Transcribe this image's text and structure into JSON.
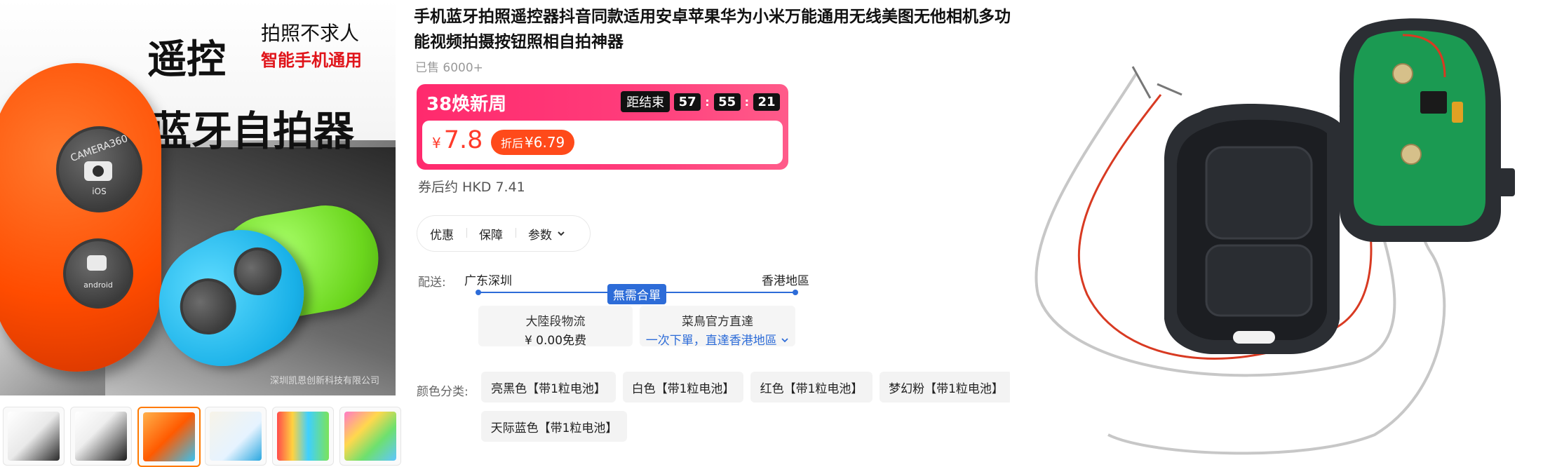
{
  "main_image": {
    "headline_1": "遥控",
    "headline_2": "拍照不求人",
    "headline_3": "智能手机通用",
    "headline_4": "蓝牙自拍器",
    "label_1": "CAMERA360",
    "label_2": "iOS",
    "label_3": "android",
    "watermark": "深圳凯恩创新科技有限公司"
  },
  "thumbnails": [
    {
      "active": false
    },
    {
      "active": false
    },
    {
      "active": true
    },
    {
      "active": false
    },
    {
      "active": false
    },
    {
      "active": false
    }
  ],
  "product": {
    "title": "手机蓝牙拍照遥控器抖音同款适用安卓苹果华为小米万能通用无线美图无他相机多功能视频拍摄按钮照相自拍神器",
    "sold": "已售 6000+"
  },
  "promo": {
    "title": "38焕新周",
    "countdown_label": "距结束",
    "hours": "57",
    "minutes": "55",
    "seconds": "21",
    "currency": "¥",
    "price": "7.8",
    "after_label": "折后",
    "after_price": "¥6.79"
  },
  "coupon_price": "券后约 HKD 7.41",
  "pills": [
    "优惠",
    "保障",
    "参数"
  ],
  "delivery": {
    "label": "配送:",
    "from": "广东深圳",
    "to": "香港地區",
    "badge": "無需合單",
    "card1_title": "大陸段物流",
    "card1_value": "¥ 0.00免费",
    "card2_title": "菜鳥官方直達",
    "card2_value": "一次下單，直達香港地區"
  },
  "colors": {
    "label": "颜色分类:",
    "options": [
      "亮黑色【带1粒电池】",
      "白色【带1粒电池】",
      "红色【带1粒电池】",
      "梦幻粉【带1粒电池】",
      "天际蓝色【带1粒电池】"
    ]
  },
  "palette": {
    "accent_red": "#ff2a6d",
    "price_red": "#ff3a2a",
    "delivery_blue": "#2d6cd8",
    "thumb_active": "#ff7a00"
  }
}
